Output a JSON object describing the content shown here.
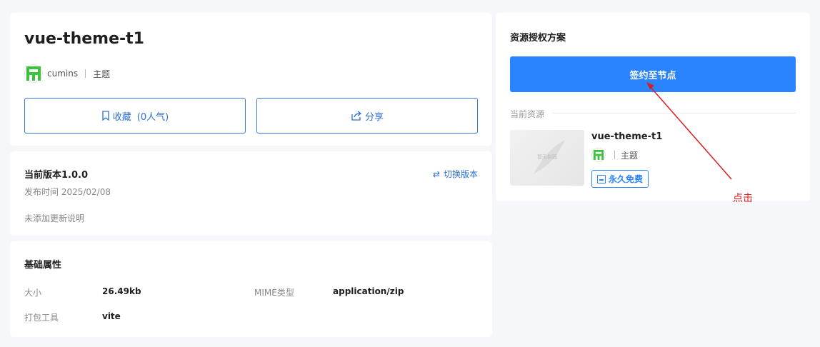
{
  "resource": {
    "title": "vue-theme-t1",
    "author": "cumins",
    "category": "主题"
  },
  "actions": {
    "favorite_label": "收藏",
    "favorite_count": "(0人气)",
    "share_label": "分享"
  },
  "version": {
    "title": "当前版本1.0.0",
    "publish_time": "发布时间 2025/02/08",
    "switch_label": "切换版本",
    "note": "未添加更新说明"
  },
  "properties": {
    "title": "基础属性",
    "items": [
      {
        "key": "大小",
        "value": "26.49kb"
      },
      {
        "key": "MIME类型",
        "value": "application/zip"
      },
      {
        "key": "打包工具",
        "value": "vite"
      }
    ]
  },
  "license": {
    "title": "资源授权方案",
    "sign_button": "签约至节点",
    "current_resource_label": "当前资源",
    "thumb_placeholder": "暂无封面",
    "resource_name": "vue-theme-t1",
    "resource_category": "主题",
    "badge": "永久免费"
  },
  "annotation": {
    "label": "点击",
    "color": "#e0191b"
  },
  "colors": {
    "accent": "#2a84fd",
    "outline": "#3a7bd5",
    "avatar_green": "#3bc33b"
  }
}
